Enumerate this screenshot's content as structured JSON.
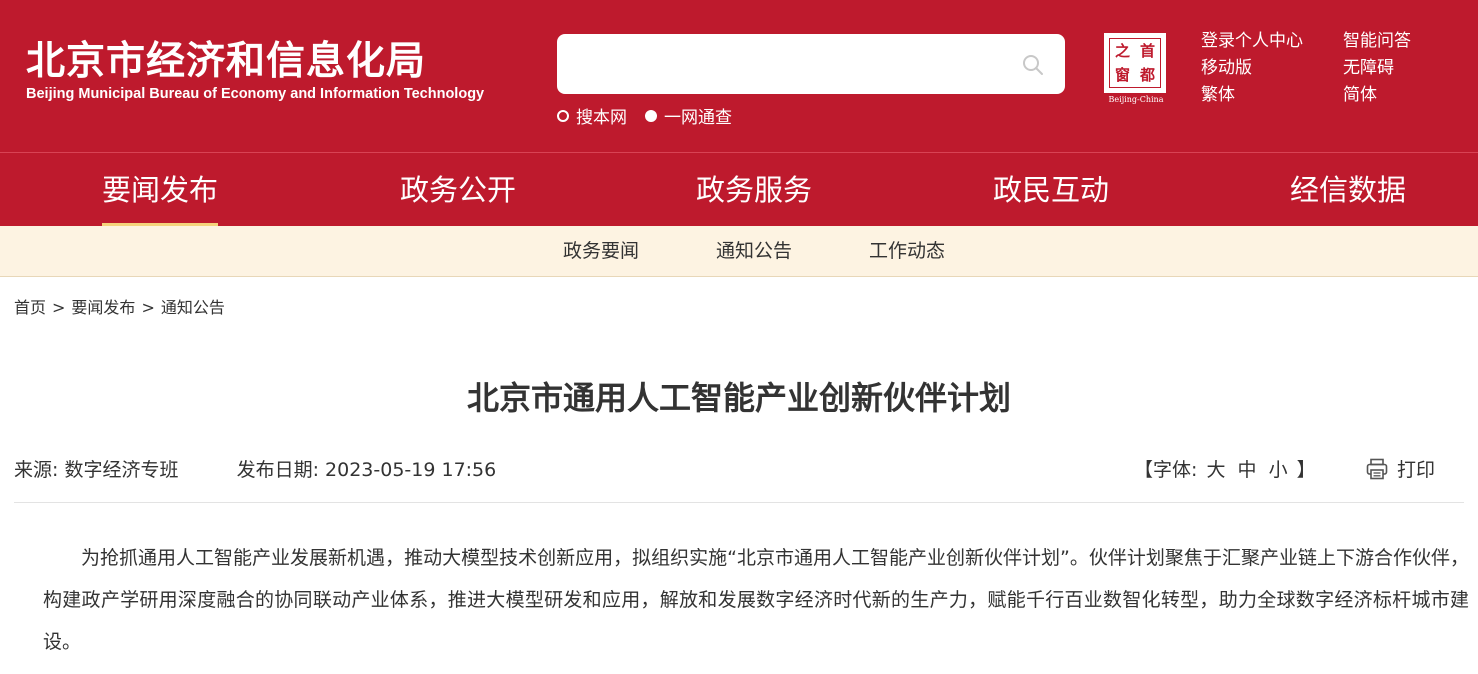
{
  "header": {
    "logo_cn": "北京市经济和信息化局",
    "logo_en": "Beijing Municipal Bureau of Economy and Information Technology",
    "search": {
      "placeholder": "",
      "value": ""
    },
    "search_options": [
      "搜本网",
      "一网通查"
    ],
    "seal": {
      "chars": [
        "之",
        "首",
        "窗",
        "都"
      ],
      "label": "Beijing-China"
    },
    "links": {
      "login": "登录个人中心",
      "qa": "智能问答",
      "mobile": "移动版",
      "accessible": "无障碍",
      "traditional": "繁体",
      "simplified": "简体"
    }
  },
  "main_nav": [
    "要闻发布",
    "政务公开",
    "政务服务",
    "政民互动",
    "经信数据"
  ],
  "sub_nav": [
    "政务要闻",
    "通知公告",
    "工作动态"
  ],
  "breadcrumb": [
    "首页",
    "要闻发布",
    "通知公告"
  ],
  "breadcrumb_sep": ">",
  "article": {
    "title": "北京市通用人工智能产业创新伙伴计划",
    "source_label": "来源:",
    "source": "数字经济专班",
    "date_label": "发布日期:",
    "date": "2023-05-19 17:56",
    "font_open": "【字体:",
    "font_large": "大",
    "font_medium": "中",
    "font_small": "小",
    "font_close": "】",
    "print_label": "打印",
    "body": "为抢抓通用人工智能产业发展新机遇，推动大模型技术创新应用，拟组织实施“北京市通用人工智能产业创新伙伴计划”。伙伴计划聚焦于汇聚产业链上下游合作伙伴，构建政产学研用深度融合的协同联动产业体系，推进大模型研发和应用，解放和发展数字经济时代新的生产力，赋能千行百业数智化转型，助力全球数字经济标杆城市建设。"
  },
  "colors": {
    "brand_red": "#be1a2d",
    "nav_active_underline": "#f5d37c",
    "subnav_bg": "#fdf3e2",
    "text": "#333333"
  },
  "icons": [
    "search-icon",
    "printer-icon"
  ]
}
